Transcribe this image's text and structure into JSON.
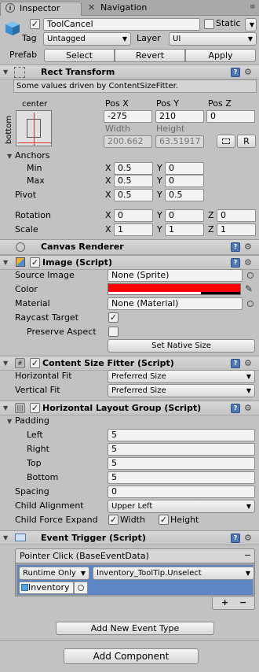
{
  "tabs": [
    {
      "label": "Inspector"
    },
    {
      "label": "Navigation"
    }
  ],
  "header": {
    "object_name": "ToolCancel",
    "static_label": "Static",
    "tag_label": "Tag",
    "tag_value": "Untagged",
    "layer_label": "Layer",
    "layer_value": "UI",
    "prefab_label": "Prefab",
    "select_label": "Select",
    "revert_label": "Revert",
    "apply_label": "Apply"
  },
  "rect_transform": {
    "title": "Rect Transform",
    "info": "Some values driven by ContentSizeFitter.",
    "anchor_h": "center",
    "anchor_v": "bottom",
    "posx_label": "Pos X",
    "posx": "-275",
    "posy_label": "Pos Y",
    "posy": "210",
    "posz_label": "Pos Z",
    "posz": "0",
    "width_label": "Width",
    "width": "200.662",
    "height_label": "Height",
    "height": "63.51917",
    "r_label": "R",
    "anchors_label": "Anchors",
    "min_label": "Min",
    "min_x": "0.5",
    "min_y": "0",
    "max_label": "Max",
    "max_x": "0.5",
    "max_y": "0",
    "pivot_label": "Pivot",
    "pivot_x": "0.5",
    "pivot_y": "0.5",
    "rotation_label": "Rotation",
    "rot_x": "0",
    "rot_y": "0",
    "rot_z": "0",
    "scale_label": "Scale",
    "scale_x": "1",
    "scale_y": "1",
    "scale_z": "1",
    "x": "X",
    "y": "Y",
    "z": "Z"
  },
  "canvas_renderer": {
    "title": "Canvas Renderer"
  },
  "image": {
    "title": "Image (Script)",
    "source_label": "Source Image",
    "source_value": "None (Sprite)",
    "color_label": "Color",
    "color_value": "#ff0000",
    "material_label": "Material",
    "material_value": "None (Material)",
    "raycast_label": "Raycast Target",
    "preserve_label": "Preserve Aspect",
    "native_label": "Set Native Size"
  },
  "fitter": {
    "title": "Content Size Fitter (Script)",
    "hfit_label": "Horizontal Fit",
    "hfit_value": "Preferred Size",
    "vfit_label": "Vertical Fit",
    "vfit_value": "Preferred Size"
  },
  "layout": {
    "title": "Horizontal Layout Group (Script)",
    "padding_label": "Padding",
    "left_label": "Left",
    "left": "5",
    "right_label": "Right",
    "right": "5",
    "top_label": "Top",
    "top": "5",
    "bottom_label": "Bottom",
    "bottom": "5",
    "spacing_label": "Spacing",
    "spacing": "0",
    "align_label": "Child Alignment",
    "align_value": "Upper Left",
    "expand_label": "Child Force Expand",
    "width_label": "Width",
    "height_label": "Height"
  },
  "event_trigger": {
    "title": "Event Trigger (Script)",
    "event_header": "Pointer Click (BaseEventData)",
    "runtime_value": "Runtime Only",
    "function_value": "Inventory_ToolTip.Unselect",
    "object_value": "Inventory",
    "plus": "+",
    "minus": "−",
    "add_event_label": "Add New Event Type"
  },
  "add_component_label": "Add Component",
  "colors": {
    "accent": "#4f78b5",
    "swatch": "#ff0000"
  }
}
